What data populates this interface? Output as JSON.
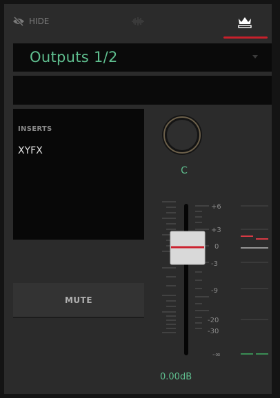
{
  "toolbar": {
    "hide_label": "HIDE",
    "hide_icon": "eye-slash-icon",
    "waveform_icon": "waveform-icon",
    "crown_icon": "crown-icon",
    "active_color": "#c8202b"
  },
  "output": {
    "selected": "Outputs 1/2",
    "text_color": "#5fbf8f"
  },
  "name_field": {
    "value": ""
  },
  "inserts": {
    "title": "INSERTS",
    "items": [
      "XYFX"
    ]
  },
  "mute": {
    "label": "MUTE"
  },
  "pan": {
    "label": "C"
  },
  "fader": {
    "gain_label": "0.00dB",
    "scale": [
      "+6",
      "+3",
      "0",
      "-3",
      "-9",
      "-20",
      "-30",
      "-∞"
    ],
    "level_db": 0
  },
  "meter": {
    "left_peak_color": "#d83a44",
    "right_peak_color": "#d83a44",
    "zero_color": "#ffffff",
    "bottom_color": "#3fae62"
  }
}
